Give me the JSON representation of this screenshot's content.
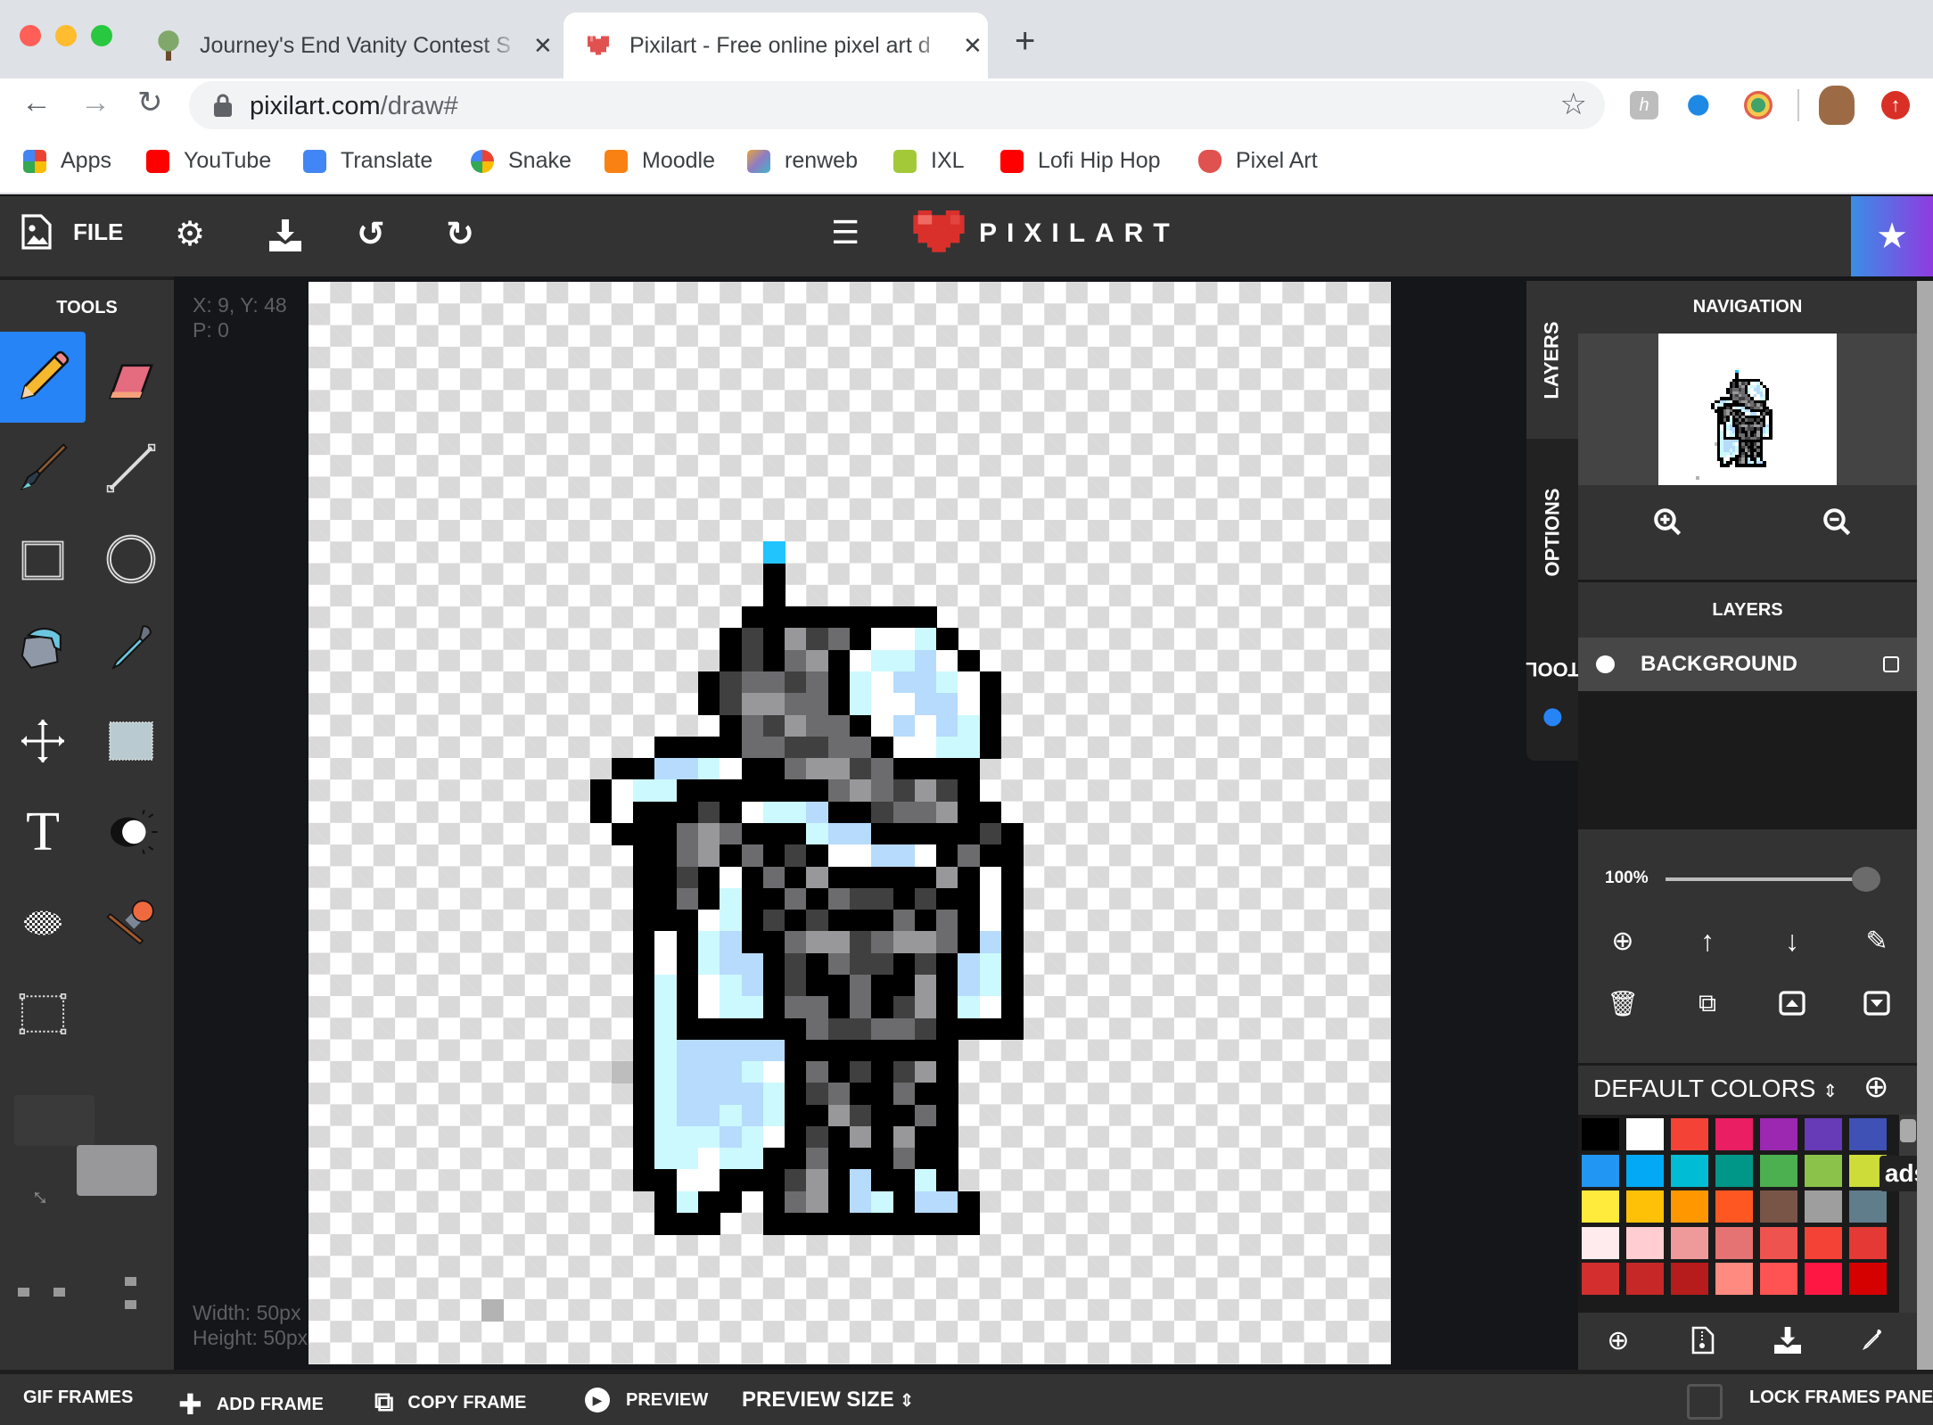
{
  "browser": {
    "tabs": [
      {
        "title": "Journey's End Vanity Contest S",
        "active": false,
        "icon": "tree-favicon"
      },
      {
        "title": "Pixilart - Free online pixel art d",
        "active": true,
        "icon": "pixel-heart-favicon"
      }
    ],
    "new_tab": "+",
    "close_glyph": "✕",
    "url_host": "pixilart.com",
    "url_path": "/draw#",
    "bookmarks": [
      {
        "label": "Apps",
        "icon": "apps-grid-icon",
        "color": "#ea4335"
      },
      {
        "label": "YouTube",
        "icon": "youtube-icon",
        "color": "#ff0000"
      },
      {
        "label": "Translate",
        "icon": "translate-icon",
        "color": "#4285f4"
      },
      {
        "label": "Snake",
        "icon": "google-icon",
        "color": "#4285f4"
      },
      {
        "label": "Moodle",
        "icon": "moodle-icon",
        "color": "#f98012"
      },
      {
        "label": "renweb",
        "icon": "renweb-icon",
        "color": "#8e7cc3"
      },
      {
        "label": "IXL",
        "icon": "ixl-icon",
        "color": "#a3c939"
      },
      {
        "label": "Lofi Hip Hop",
        "icon": "youtube-icon",
        "color": "#ff0000"
      },
      {
        "label": "Pixel Art",
        "icon": "pixel-heart-icon",
        "color": "#e0524f"
      }
    ]
  },
  "app": {
    "file_label": "FILE",
    "logo_text": "PIXILART",
    "tools_title": "TOOLS",
    "tools": [
      "pencil",
      "eraser",
      "brush",
      "line",
      "rectangle",
      "circle",
      "bucket",
      "eyedropper",
      "move",
      "selection-fill",
      "text",
      "lighten",
      "dither",
      "stamp",
      "select"
    ],
    "active_tool": "pencil",
    "cursor_readout": "X: 9, Y: 48",
    "pressure_readout": "P: 0",
    "width_readout": "Width: 50px",
    "height_readout": "Height: 50px",
    "primary_color": "#3c3c3c",
    "secondary_color": "#98979a",
    "side_tabs": [
      "LAYERS",
      "OPTIONS",
      "TOOL"
    ],
    "active_side_tab": "LAYERS",
    "navigation_title": "NAVIGATION",
    "layers_title": "LAYERS",
    "layers": [
      {
        "name": "BACKGROUND",
        "visible": true
      }
    ],
    "layer_opacity_label": "100%",
    "layer_opacity": 1.0,
    "palette_title": "DEFAULT COLORS",
    "palette": [
      "#000000",
      "#ffffff",
      "#f44336",
      "#e91e63",
      "#9c27b0",
      "#673ab7",
      "#3f51b5",
      "#2196f3",
      "#03a9f4",
      "#00bcd4",
      "#009688",
      "#4caf50",
      "#8bc34a",
      "#cddc39",
      "#ffeb3b",
      "#ffc107",
      "#ff9800",
      "#ff5722",
      "#795548",
      "#9e9e9e",
      "#607d8b",
      "#ffebee",
      "#ffcdd2",
      "#ef9a9a",
      "#e57373",
      "#ef5350",
      "#f44336",
      "#e53935",
      "#d32f2f",
      "#c62828",
      "#b71c1c",
      "#ff8a80",
      "#ff5252",
      "#ff1744",
      "#d50000"
    ],
    "ads_label": "ads",
    "bottom": {
      "gif_frames": "GIF FRAMES",
      "add_frame": "ADD FRAME",
      "copy_frame": "COPY FRAME",
      "preview": "PREVIEW",
      "preview_size": "PREVIEW SIZE",
      "lock_frames": "LOCK FRAMES PANEL"
    }
  },
  "sprite": {
    "grid_size": 50,
    "colors": {
      "K": "#000000",
      "D": "#404040",
      "M": "#6c6b6e",
      "L": "#98979a",
      "W": "#ffffff",
      "C": "#ccf9fd",
      "B": "#b6dbfc",
      "S": "#22c4fd",
      "G": "#b3b3b3",
      "H": "#bdbdbd"
    },
    "rows": {
      "12": {
        "21": "S"
      },
      "13": {
        "21": "K"
      },
      "14": {
        "21": "K"
      },
      "15": {
        "20": "KKKKKKKKK"
      },
      "16": {
        "19": "KDKLDMKWWCK"
      },
      "17": {
        "19": "KDKMLKWCCBWK"
      },
      "18": {
        "18": "KDMMDMKCWBBCWK"
      },
      "19": {
        "18": "KDLLMMKCWWBBWK"
      },
      "20": {
        "19": "KMDLMMKWBWBCK"
      },
      "21": {
        "16": "KKKKMMDDMMKWWCCK"
      },
      "22": {
        "14": "KKBBCWKKMLLDMKKKK"
      },
      "23": {
        "13": "KWCCKKKKKKKMLMDLDK"
      },
      "24": {
        "13": "KWKKKDKWCCBKKDMMLKK"
      },
      "25": {
        "14": "KKKMLMKKKCBBKKKKKDK"
      },
      "26": {
        "15": "KKMLKMKDKWWBBWKMKK"
      },
      "27": {
        "15": "KKDKWKMKLKKKKKLKWK"
      },
      "28": {
        "15": "KKMKCKKMKMDDKDKKWK"
      },
      "29": {
        "15": "KKKWCKDKDKKKMKMKWK"
      },
      "30": {
        "15": "KWKCBKKMLLDMLLMKBK"
      },
      "31": {
        "15": "KWKCBBKDKMDDKDKBCK"
      },
      "32": {
        "15": "KCKWCBKDKKMKKLKBCK"
      },
      "33": {
        "15": "KCKWCCKMMKMKDLKCWK"
      },
      "34": {
        "15": "KCKKKKKKMDDMMDKKKK"
      },
      "35": {
        "15": "KCBBBBBKKKKKKKK"
      },
      "36": {
        "14": "HKCBBBCWKMKDKDLK"
      },
      "37": {
        "15": "KCBBBBCKDMKKMKK"
      },
      "38": {
        "15": "KCBBCBCKKLDKKMK"
      },
      "39": {
        "15": "KCCCBCWKDKLKLKK"
      },
      "40": {
        "15": "KCCWCCKKMKKKMKK"
      },
      "41": {
        "15": "KKWWKKKDLKBKKCK"
      },
      "42": {
        "16": "KCKK.KMLKBCKBBK"
      },
      "43": {
        "16": "KKK..KKKKKKKKKK"
      },
      "47": {
        "8": "G"
      }
    }
  }
}
